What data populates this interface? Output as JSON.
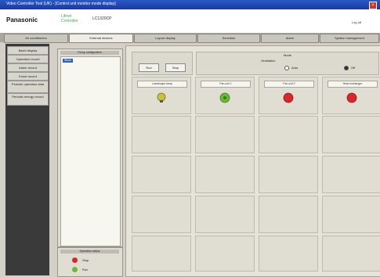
{
  "window": {
    "title": "Video Controller Tool (UK) - [Control unit monitor mode display]"
  },
  "header": {
    "logo": "Panasonic",
    "product_line1": "Lifinet",
    "product_line2": "Controller",
    "model": "LC1320CP",
    "logout_label": "Log off"
  },
  "tabs": [
    {
      "label": "Air conditioners"
    },
    {
      "label": "External devices"
    },
    {
      "label": "Layout display"
    },
    {
      "label": "Schedule"
    },
    {
      "label": "Alarm"
    },
    {
      "label": "System management"
    }
  ],
  "sidebar": {
    "items": [
      {
        "label": "Batch display"
      },
      {
        "label": "Operation record"
      },
      {
        "label": "Alarm record"
      },
      {
        "label": "Event record"
      },
      {
        "label": "Periodic operation data"
      },
      {
        "label": "Periodic energy record"
      }
    ]
  },
  "tree": {
    "header": "Group configuration",
    "selected_item": "Block"
  },
  "legend": {
    "header": "Operation status",
    "items": [
      {
        "label": "Stop",
        "color": "#d8282a"
      },
      {
        "label": "Run",
        "color": "#6ab83a"
      }
    ]
  },
  "controls": {
    "left_label": "Run",
    "right_label": "Stop"
  },
  "mode": {
    "title": "Mode",
    "label": "Ventilation",
    "options": [
      {
        "label": "Auto",
        "selected": false
      },
      {
        "label": "Off",
        "selected": true
      }
    ]
  },
  "devices": [
    {
      "name": "Landscape lamp",
      "status": "warning",
      "color": "#c7c23a"
    },
    {
      "name": "Fan coil 1",
      "status": "run",
      "color": "#6ab83a"
    },
    {
      "name": "Fan coil 2",
      "status": "stop",
      "color": "#d8282a"
    },
    {
      "name": "Heat exchanger",
      "status": "stop",
      "color": "#d8282a"
    }
  ],
  "colors": {
    "titlebar": "#1a3a9e",
    "selected": "#2f5fc5"
  }
}
